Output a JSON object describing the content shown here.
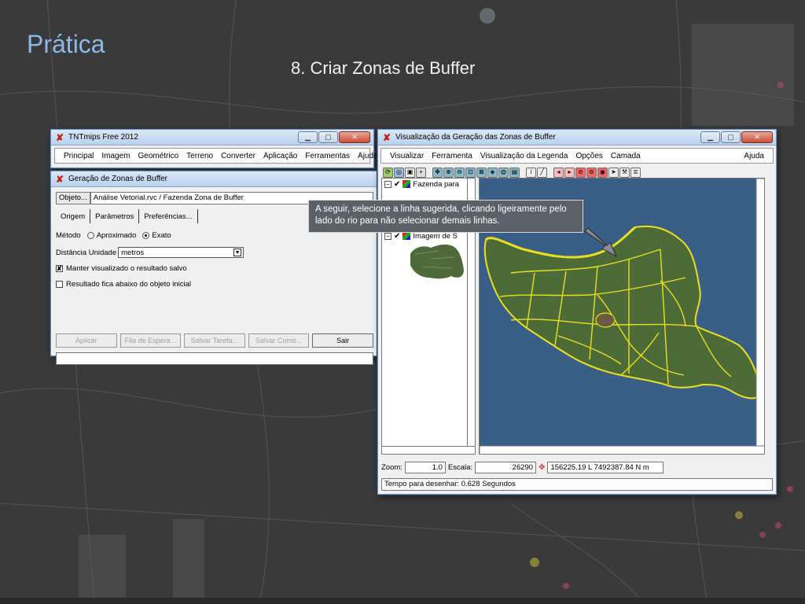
{
  "slide": {
    "title": "Prática",
    "subtitle": "8. Criar Zonas de Buffer"
  },
  "tnt_window": {
    "title": "TNTmips Free 2012",
    "menu": [
      "Principal",
      "Imagem",
      "Geométrico",
      "Terreno",
      "Converter",
      "Aplicação",
      "Ferramentas",
      "Ajuda"
    ]
  },
  "buffer_dialog": {
    "title": "Geração de Zonas de Buffer",
    "object_button": "Objeto...",
    "object_path": "Análise Vetorial.rvc / Fazenda Zona de Buffer",
    "tabs": [
      "Origem",
      "Parâmetros",
      "Preferências..."
    ],
    "method_label": "Método",
    "method_options": [
      "Aproximado",
      "Exato"
    ],
    "method_selected": "Exato",
    "distance_label": "Distância Unidade",
    "distance_unit": "metros",
    "check_keep_label": "Manter visualizado o resultado salvo",
    "check_keep": true,
    "check_below_label": "Resultado fica abaixo do objeto inicial",
    "check_below": false,
    "buttons": {
      "apply": "Aplicar",
      "queue": "Fila de Espera...",
      "save_task": "Salvar Tarefa...",
      "save_as": "Salvar Como...",
      "exit": "Sair"
    }
  },
  "vis_window": {
    "title": "Visualização da Geração das Zonas de Buffer",
    "menu": [
      "Visualizar",
      "Ferramenta",
      "Visualização da Legenda",
      "Opções",
      "Camada"
    ],
    "help": "Ajuda",
    "layers": [
      {
        "name": "Fazenda para",
        "checked": true
      },
      {
        "name": "Imagem de S",
        "checked": true
      }
    ],
    "zoom_label": "Zoom:",
    "zoom_value": "1.0",
    "scale_label": "Escala:",
    "scale_value": "26290",
    "coordinates": "156225.19 L  7492387.84 N m",
    "status": "Tempo para desenhar: 0.628 Segundos"
  },
  "callout": {
    "text": "A seguir, selecione a linha sugerida, clicando ligeiramente pelo lado do rio para não selecionar demais linhas."
  },
  "colors": {
    "title_blue": "#8fb8e8",
    "map_water": "#3a5f86",
    "vector_lines": "#e8e020"
  }
}
